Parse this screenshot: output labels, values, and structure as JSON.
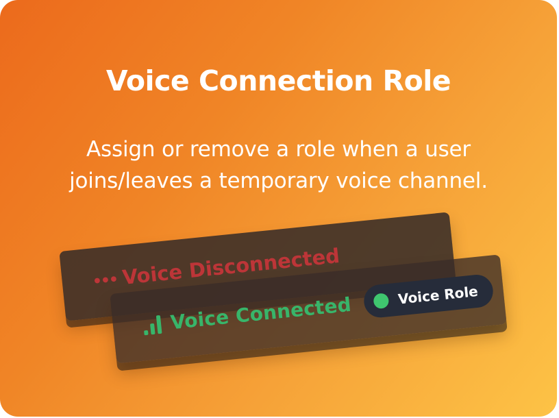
{
  "card": {
    "title": "Voice Connection Role",
    "subtitle_line1": "Assign or remove a role when a user",
    "subtitle_line2": "joins/leaves a temporary voice channel."
  },
  "illustration": {
    "disconnected_label": "Voice Disconnected",
    "disconnected_icon": "ellipsis-dots-icon",
    "connected_label": "Voice Connected",
    "connected_icon": "signal-bars-icon",
    "role_label": "Voice Role",
    "role_icon": "status-dot-icon"
  },
  "colors": {
    "gradient_start": "#ec6a1c",
    "gradient_end": "#fdc346",
    "disconnected_red": "#c9353a",
    "connected_green": "#38b56a",
    "role_pill_bg": "#262c3a",
    "role_dot_green": "#3fc66f"
  }
}
